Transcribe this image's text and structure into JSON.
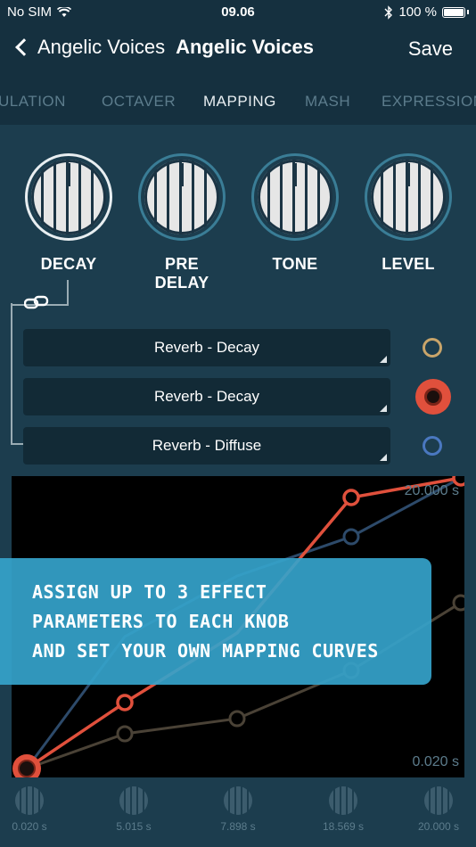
{
  "status_bar": {
    "carrier": "No SIM",
    "time": "09.06",
    "battery": "100 %"
  },
  "nav": {
    "back_label": "Angelic Voices",
    "title": "Angelic Voices",
    "save_label": "Save"
  },
  "tabs": [
    {
      "label": "ULATION"
    },
    {
      "label": "OCTAVER"
    },
    {
      "label": "MAPPING"
    },
    {
      "label": "MASH"
    },
    {
      "label": "EXPRESSION"
    }
  ],
  "knobs": [
    {
      "label": "DECAY"
    },
    {
      "label": "PRE DELAY"
    },
    {
      "label": "TONE"
    },
    {
      "label": "LEVEL"
    }
  ],
  "params": [
    {
      "label": "Reverb - Decay",
      "color": "#c9a56a"
    },
    {
      "label": "Reverb - Decay",
      "color": "#e0503c"
    },
    {
      "label": "Reverb - Diffuse",
      "color": "#4a78c0"
    }
  ],
  "graph": {
    "max_label": "20.000 s",
    "min_label": "0.020 s"
  },
  "promo": {
    "line1": "ASSIGN UP TO 3 EFFECT",
    "line2": "PARAMETERS TO EACH KNOB",
    "line3": "AND SET YOUR OWN MAPPING CURVES"
  },
  "mini_knobs": [
    {
      "value": "0.020 s"
    },
    {
      "value": "5.015 s"
    },
    {
      "value": "7.898 s"
    },
    {
      "value": "18.569 s"
    },
    {
      "value": "20.000 s"
    }
  ],
  "colors": {
    "accent": "#35a3cb",
    "curve_active": "#e0503c",
    "curve_blue": "#2d4a6a",
    "curve_tan": "#4a4236"
  }
}
